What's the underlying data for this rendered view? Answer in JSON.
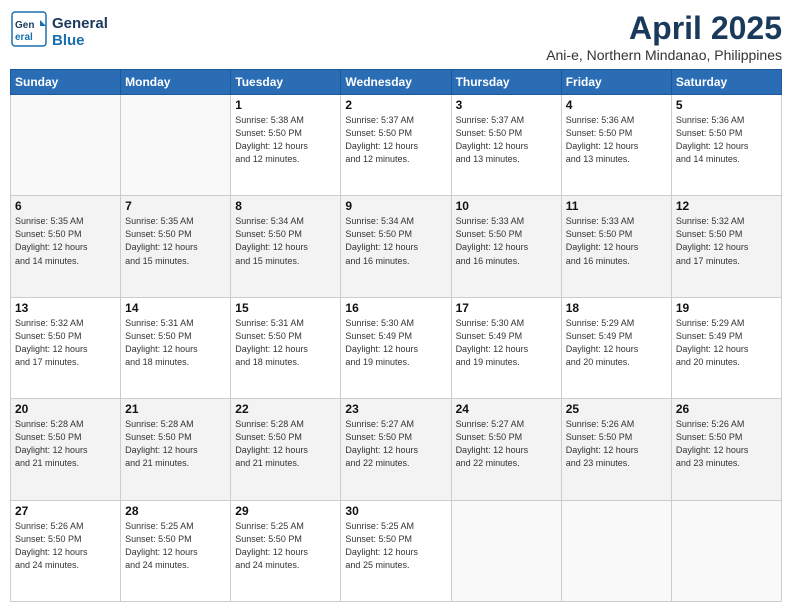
{
  "logo": {
    "line1": "General",
    "line2": "Blue"
  },
  "title": "April 2025",
  "subtitle": "Ani-e, Northern Mindanao, Philippines",
  "header_days": [
    "Sunday",
    "Monday",
    "Tuesday",
    "Wednesday",
    "Thursday",
    "Friday",
    "Saturday"
  ],
  "weeks": [
    [
      {
        "day": "",
        "info": ""
      },
      {
        "day": "",
        "info": ""
      },
      {
        "day": "1",
        "info": "Sunrise: 5:38 AM\nSunset: 5:50 PM\nDaylight: 12 hours\nand 12 minutes."
      },
      {
        "day": "2",
        "info": "Sunrise: 5:37 AM\nSunset: 5:50 PM\nDaylight: 12 hours\nand 12 minutes."
      },
      {
        "day": "3",
        "info": "Sunrise: 5:37 AM\nSunset: 5:50 PM\nDaylight: 12 hours\nand 13 minutes."
      },
      {
        "day": "4",
        "info": "Sunrise: 5:36 AM\nSunset: 5:50 PM\nDaylight: 12 hours\nand 13 minutes."
      },
      {
        "day": "5",
        "info": "Sunrise: 5:36 AM\nSunset: 5:50 PM\nDaylight: 12 hours\nand 14 minutes."
      }
    ],
    [
      {
        "day": "6",
        "info": "Sunrise: 5:35 AM\nSunset: 5:50 PM\nDaylight: 12 hours\nand 14 minutes."
      },
      {
        "day": "7",
        "info": "Sunrise: 5:35 AM\nSunset: 5:50 PM\nDaylight: 12 hours\nand 15 minutes."
      },
      {
        "day": "8",
        "info": "Sunrise: 5:34 AM\nSunset: 5:50 PM\nDaylight: 12 hours\nand 15 minutes."
      },
      {
        "day": "9",
        "info": "Sunrise: 5:34 AM\nSunset: 5:50 PM\nDaylight: 12 hours\nand 16 minutes."
      },
      {
        "day": "10",
        "info": "Sunrise: 5:33 AM\nSunset: 5:50 PM\nDaylight: 12 hours\nand 16 minutes."
      },
      {
        "day": "11",
        "info": "Sunrise: 5:33 AM\nSunset: 5:50 PM\nDaylight: 12 hours\nand 16 minutes."
      },
      {
        "day": "12",
        "info": "Sunrise: 5:32 AM\nSunset: 5:50 PM\nDaylight: 12 hours\nand 17 minutes."
      }
    ],
    [
      {
        "day": "13",
        "info": "Sunrise: 5:32 AM\nSunset: 5:50 PM\nDaylight: 12 hours\nand 17 minutes."
      },
      {
        "day": "14",
        "info": "Sunrise: 5:31 AM\nSunset: 5:50 PM\nDaylight: 12 hours\nand 18 minutes."
      },
      {
        "day": "15",
        "info": "Sunrise: 5:31 AM\nSunset: 5:50 PM\nDaylight: 12 hours\nand 18 minutes."
      },
      {
        "day": "16",
        "info": "Sunrise: 5:30 AM\nSunset: 5:49 PM\nDaylight: 12 hours\nand 19 minutes."
      },
      {
        "day": "17",
        "info": "Sunrise: 5:30 AM\nSunset: 5:49 PM\nDaylight: 12 hours\nand 19 minutes."
      },
      {
        "day": "18",
        "info": "Sunrise: 5:29 AM\nSunset: 5:49 PM\nDaylight: 12 hours\nand 20 minutes."
      },
      {
        "day": "19",
        "info": "Sunrise: 5:29 AM\nSunset: 5:49 PM\nDaylight: 12 hours\nand 20 minutes."
      }
    ],
    [
      {
        "day": "20",
        "info": "Sunrise: 5:28 AM\nSunset: 5:50 PM\nDaylight: 12 hours\nand 21 minutes."
      },
      {
        "day": "21",
        "info": "Sunrise: 5:28 AM\nSunset: 5:50 PM\nDaylight: 12 hours\nand 21 minutes."
      },
      {
        "day": "22",
        "info": "Sunrise: 5:28 AM\nSunset: 5:50 PM\nDaylight: 12 hours\nand 21 minutes."
      },
      {
        "day": "23",
        "info": "Sunrise: 5:27 AM\nSunset: 5:50 PM\nDaylight: 12 hours\nand 22 minutes."
      },
      {
        "day": "24",
        "info": "Sunrise: 5:27 AM\nSunset: 5:50 PM\nDaylight: 12 hours\nand 22 minutes."
      },
      {
        "day": "25",
        "info": "Sunrise: 5:26 AM\nSunset: 5:50 PM\nDaylight: 12 hours\nand 23 minutes."
      },
      {
        "day": "26",
        "info": "Sunrise: 5:26 AM\nSunset: 5:50 PM\nDaylight: 12 hours\nand 23 minutes."
      }
    ],
    [
      {
        "day": "27",
        "info": "Sunrise: 5:26 AM\nSunset: 5:50 PM\nDaylight: 12 hours\nand 24 minutes."
      },
      {
        "day": "28",
        "info": "Sunrise: 5:25 AM\nSunset: 5:50 PM\nDaylight: 12 hours\nand 24 minutes."
      },
      {
        "day": "29",
        "info": "Sunrise: 5:25 AM\nSunset: 5:50 PM\nDaylight: 12 hours\nand 24 minutes."
      },
      {
        "day": "30",
        "info": "Sunrise: 5:25 AM\nSunset: 5:50 PM\nDaylight: 12 hours\nand 25 minutes."
      },
      {
        "day": "",
        "info": ""
      },
      {
        "day": "",
        "info": ""
      },
      {
        "day": "",
        "info": ""
      }
    ]
  ]
}
